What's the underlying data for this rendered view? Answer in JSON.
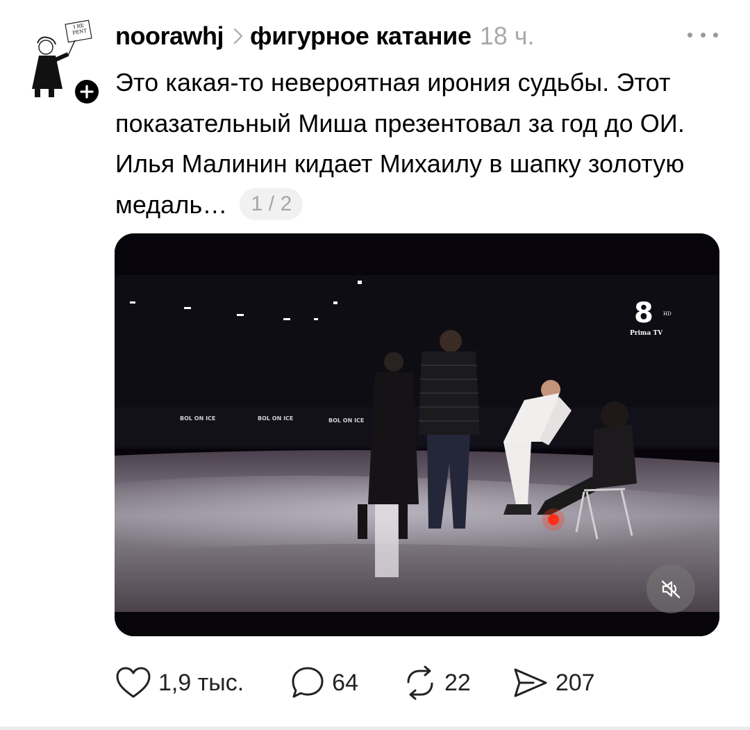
{
  "post": {
    "username": "noorawhj",
    "topic": "фигурное катание",
    "time": "18 ч.",
    "text": "Это какая-то невероятная ирония судьбы. Этот показательный Миша презентовал за год до ОИ. Илья Малинин кидает Михаилу в шапку золотую медаль…",
    "pager": "1 / 2",
    "avatar_sign_text": "I RE PENT"
  },
  "media": {
    "channel_logo": "8",
    "channel_hd": "HD",
    "channel_name": "Prima TV",
    "board_text": "BOL ON ICE",
    "mute_icon": "speaker-muted-icon"
  },
  "actions": {
    "likes": "1,9 тыс.",
    "comments": "64",
    "reposts": "22",
    "shares": "207"
  },
  "colors": {
    "text": "#000000",
    "muted": "#a9a9a9",
    "pager_bg": "#f1f1f1",
    "media_bg": "#06040a"
  }
}
